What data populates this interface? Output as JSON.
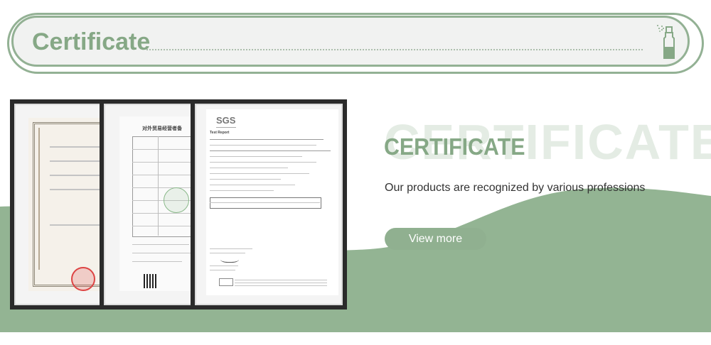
{
  "header": {
    "title": "Certificate",
    "icon": "spray-bottle-icon"
  },
  "main": {
    "watermark": "CERTIFICATE",
    "title": "CERTIFICATE",
    "subtitle": "Our products are recognized by various professions",
    "button_label": "View more"
  },
  "documents": {
    "third": {
      "logo": "SGS",
      "report_title": "Test Report"
    },
    "second": {
      "heading": "对外贸易经营者备"
    }
  },
  "colors": {
    "accent": "#86a886",
    "wave": "#93b493",
    "button": "#90b090"
  }
}
